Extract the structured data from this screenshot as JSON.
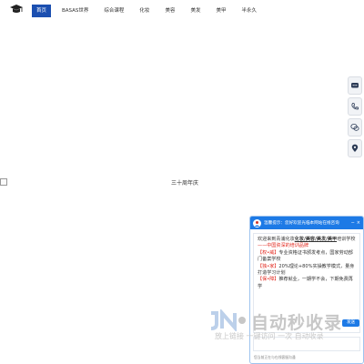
{
  "nav": {
    "items": [
      "首页",
      "BASAS世界",
      "综合课程",
      "化妆",
      "美容",
      "美发",
      "美甲",
      "半永久"
    ],
    "active_index": 0,
    "accent": "#1b4fb0"
  },
  "floating_tools": [
    "chat-icon",
    "phone-icon",
    "wechat-icon",
    "location-icon"
  ],
  "banner": {
    "caption": "三十周年庆"
  },
  "chat": {
    "header_title": "温馨提示：您好欢迎光临本网站在线咨询",
    "minimize": "−",
    "close": "×",
    "accent": "#1d7ae6",
    "message": {
      "line1_prefix": "欢迎来到青浦化妆",
      "line1_highlight": "化妆/美容/美发/美甲",
      "line1_suffix": "培训学校",
      "line2": "——中国资深的培训品牌",
      "items": [
        {
          "tag": "【权•威】",
          "text": "专业资格证书颁发考点，国家劳动部门备案学校"
        },
        {
          "tag": "【独•家】",
          "text": "20%理论+80%实操教学模式，量身打造学习计划"
        },
        {
          "tag": "【保•障】",
          "text": "推荐就业，一期学不会，下期免费再学"
        }
      ]
    },
    "send_label": "发送",
    "footer": "您当前正在与在线客服沟通"
  },
  "watermark": {
    "title": "自动秒收录",
    "subtitle": "放上链接 一键访问 一次 自动收录"
  }
}
